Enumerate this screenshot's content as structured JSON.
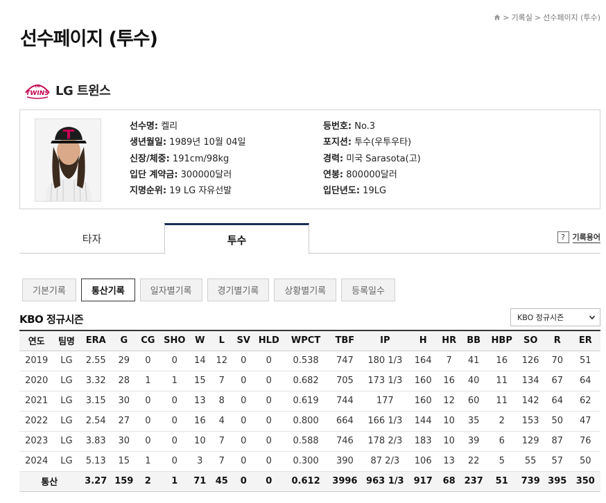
{
  "breadcrumb": {
    "home": "home-icon",
    "sep1": ">",
    "item1": "기록실",
    "sep2": ">",
    "item2": "선수페이지 (투수)"
  },
  "page_title": "선수페이지 (투수)",
  "team": {
    "logo_text_top": "LG",
    "logo_text": "TWINS",
    "name": "LG 트윈스",
    "logo_color": "#c30452"
  },
  "player": {
    "col1": [
      {
        "key": "선수명:",
        "value": " 켈리"
      },
      {
        "key": "생년월일:",
        "value": " 1989년 10월 04일"
      },
      {
        "key": "신장/체중:",
        "value": " 191cm/98kg"
      },
      {
        "key": "입단 계약금:",
        "value": " 300000달러"
      },
      {
        "key": "지명순위:",
        "value": " 19 LG 자유선발"
      }
    ],
    "col2": [
      {
        "key": "등번호:",
        "value": " No.3"
      },
      {
        "key": "포지션:",
        "value": " 투수(우투우타)"
      },
      {
        "key": "경력:",
        "value": " 미국 Sarasota(고)"
      },
      {
        "key": "연봉:",
        "value": " 800000달러"
      },
      {
        "key": "입단년도:",
        "value": " 19LG"
      }
    ]
  },
  "tabs": {
    "batter": "타자",
    "pitcher": "투수",
    "active": "투수"
  },
  "glossary": {
    "icon": "?",
    "label": "기록용어"
  },
  "subtabs": [
    "기본기록",
    "통산기록",
    "일자별기록",
    "경기별기록",
    "상황별기록",
    "등록일수"
  ],
  "subtab_active": "통산기록",
  "section_title": "KBO 정규시즌",
  "season_select": {
    "value": "KBO 정규시즌"
  },
  "table": {
    "headers": [
      "연도",
      "팀명",
      "ERA",
      "G",
      "CG",
      "SHO",
      "W",
      "L",
      "SV",
      "HLD",
      "WPCT",
      "TBF",
      "IP",
      "H",
      "HR",
      "BB",
      "HBP",
      "SO",
      "R",
      "ER"
    ],
    "rows": [
      [
        "2019",
        "LG",
        "2.55",
        "29",
        "0",
        "0",
        "14",
        "12",
        "0",
        "0",
        "0.538",
        "747",
        "180 1/3",
        "164",
        "7",
        "41",
        "16",
        "126",
        "70",
        "51"
      ],
      [
        "2020",
        "LG",
        "3.32",
        "28",
        "1",
        "1",
        "15",
        "7",
        "0",
        "0",
        "0.682",
        "705",
        "173 1/3",
        "160",
        "16",
        "40",
        "11",
        "134",
        "67",
        "64"
      ],
      [
        "2021",
        "LG",
        "3.15",
        "30",
        "0",
        "0",
        "13",
        "8",
        "0",
        "0",
        "0.619",
        "744",
        "177",
        "160",
        "12",
        "60",
        "11",
        "142",
        "64",
        "62"
      ],
      [
        "2022",
        "LG",
        "2.54",
        "27",
        "0",
        "0",
        "16",
        "4",
        "0",
        "0",
        "0.800",
        "664",
        "166 1/3",
        "144",
        "10",
        "35",
        "2",
        "153",
        "50",
        "47"
      ],
      [
        "2023",
        "LG",
        "3.83",
        "30",
        "0",
        "0",
        "10",
        "7",
        "0",
        "0",
        "0.588",
        "746",
        "178 2/3",
        "183",
        "10",
        "39",
        "6",
        "129",
        "87",
        "76"
      ],
      [
        "2024",
        "LG",
        "5.13",
        "15",
        "1",
        "0",
        "3",
        "7",
        "0",
        "0",
        "0.300",
        "390",
        "87 2/3",
        "106",
        "13",
        "22",
        "5",
        "55",
        "57",
        "50"
      ]
    ],
    "total": [
      "통산",
      "3.27",
      "159",
      "2",
      "1",
      "71",
      "45",
      "0",
      "0",
      "0.612",
      "3996",
      "963 1/3",
      "917",
      "68",
      "237",
      "51",
      "739",
      "395",
      "350"
    ]
  }
}
